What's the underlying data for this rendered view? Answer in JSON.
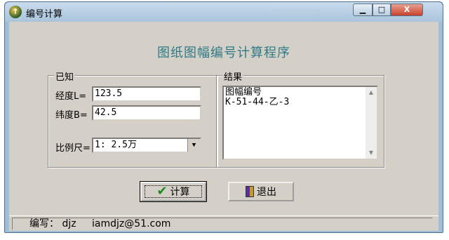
{
  "window": {
    "title": "编号计算",
    "controls": {
      "minimize": "▁",
      "maximize": "□",
      "close": "X"
    }
  },
  "app_title": "图纸图幅编号计算程序",
  "known": {
    "group_label": "已知",
    "longitude": {
      "label": "经度L=",
      "value": "123.5"
    },
    "latitude": {
      "label": "纬度B=",
      "value": "42.5"
    },
    "scale": {
      "label": "比例尺=",
      "selected": "1: 2.5万"
    }
  },
  "result": {
    "group_label": "结果",
    "text": "图幅编号\nK-51-44-乙-3"
  },
  "buttons": {
    "calculate": "计算",
    "exit": "退出"
  },
  "status": {
    "author": "编写： djz",
    "email": "iamdjz@51.com"
  },
  "colors": {
    "title_text": "#2f7a86",
    "dialog_bg": "#d4d0c8",
    "close_button": "#c8412b"
  },
  "icons": {
    "app": "app-logo-icon",
    "calculate": "checkmark-icon",
    "exit": "exit-door-icon"
  }
}
